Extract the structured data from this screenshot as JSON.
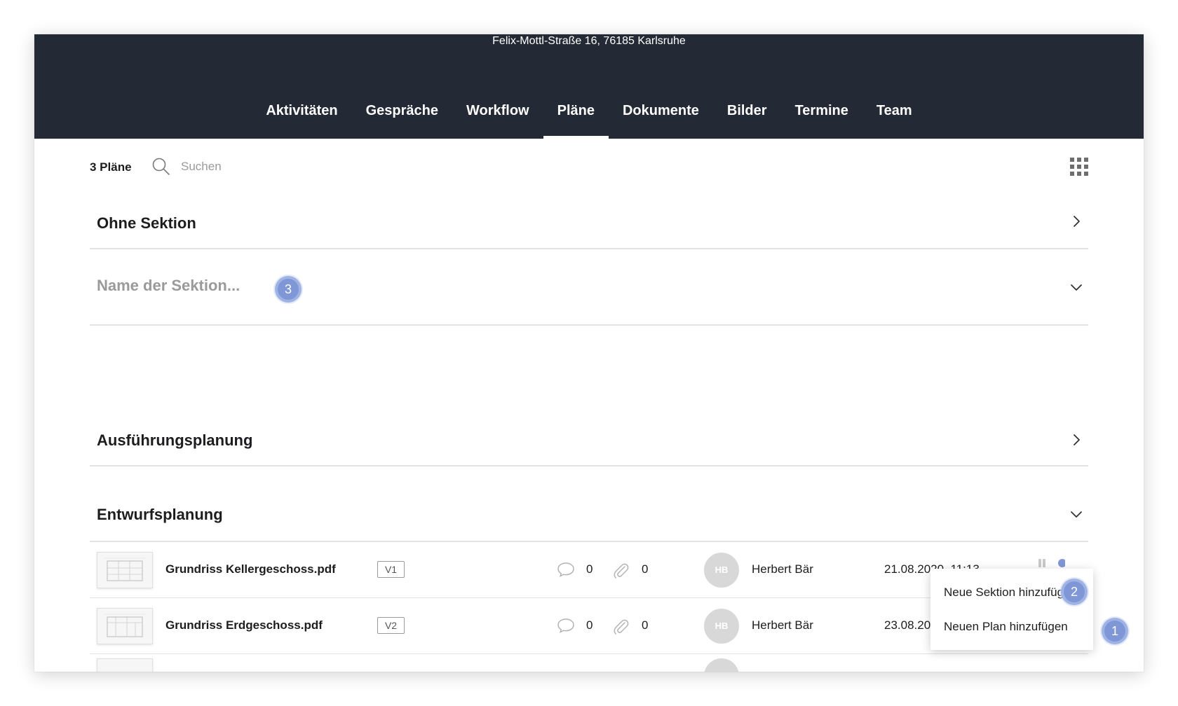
{
  "header": {
    "address": "Felix-Mottl-Straße 16, 76185 Karlsruhe",
    "tabs": [
      {
        "label": "Aktivitäten"
      },
      {
        "label": "Gespräche"
      },
      {
        "label": "Workflow"
      },
      {
        "label": "Pläne"
      },
      {
        "label": "Dokumente"
      },
      {
        "label": "Bilder"
      },
      {
        "label": "Termine"
      },
      {
        "label": "Team"
      }
    ],
    "active_tab": "Pläne"
  },
  "toolbar": {
    "count_label": "3 Pläne",
    "search_placeholder": "Suchen"
  },
  "sections": {
    "without": {
      "title": "Ohne Sektion"
    },
    "new": {
      "placeholder": "Name der Sektion...",
      "badge": "3"
    },
    "execution": {
      "title": "Ausführungsplanung"
    },
    "design": {
      "title": "Entwurfsplanung"
    }
  },
  "plans": [
    {
      "name": "Grundriss Kellergeschoss.pdf",
      "version": "V1",
      "comments": "0",
      "attachments": "0",
      "initials": "HB",
      "author": "Herbert Bär",
      "date": "21.08.2020, 11:13"
    },
    {
      "name": "Grundriss Erdgeschoss.pdf",
      "version": "V2",
      "comments": "0",
      "attachments": "0",
      "initials": "HB",
      "author": "Herbert Bär",
      "date": "23.08.2020"
    }
  ],
  "menu": {
    "items": [
      {
        "label": "Neue Sektion hinzufügen",
        "badge": "2"
      },
      {
        "label": "Neuen Plan hinzufügen",
        "badge": "1"
      }
    ]
  },
  "colors": {
    "header_bg": "#232a36",
    "badge": "#7f97d6",
    "divider": "#e3e3e3"
  }
}
